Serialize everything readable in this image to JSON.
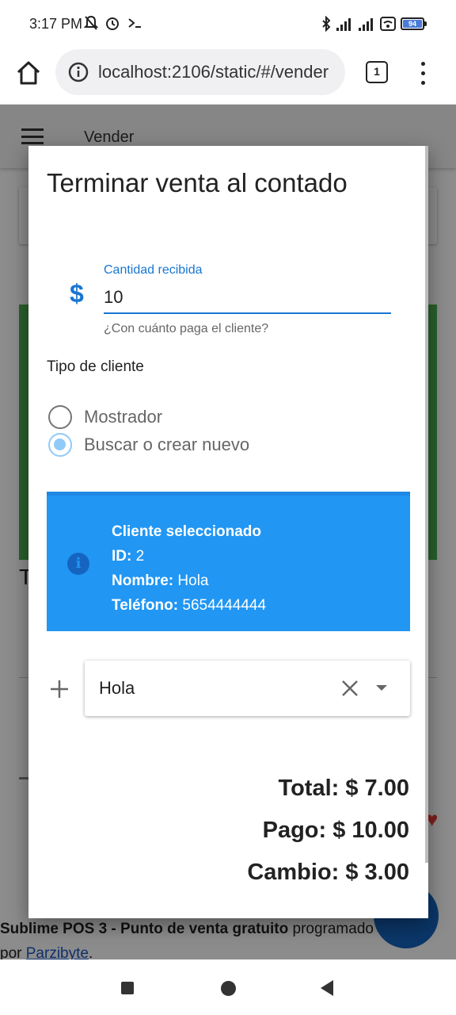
{
  "status_bar": {
    "time": "3:17 PM",
    "left_icons": [
      "notifications-off-icon",
      "alarm-icon",
      "terminal-icon"
    ],
    "right_icons": [
      "bluetooth-icon",
      "signal-icon",
      "signal-icon",
      "wifi-icon"
    ],
    "battery_level": "94"
  },
  "browser": {
    "url": "localhost:2106/static/#/vender",
    "tab_count": "1"
  },
  "app": {
    "title": "Vender"
  },
  "dialog": {
    "title": "Terminar venta al contado",
    "amount_field": {
      "label": "Cantidad recibida",
      "value": "10",
      "hint": "¿Con cuánto paga el cliente?"
    },
    "client_type_label": "Tipo de cliente",
    "client_types": [
      {
        "label": "Mostrador",
        "selected": false
      },
      {
        "label": "Buscar o crear nuevo",
        "selected": true
      }
    ],
    "selected_client": {
      "heading": "Cliente seleccionado",
      "id_label": "ID:",
      "id_value": "2",
      "name_label": "Nombre:",
      "name_value": "Hola",
      "phone_label": "Teléfono:",
      "phone_value": "5654444444"
    },
    "client_select": {
      "value": "Hola"
    },
    "totals": {
      "total": "Total: $ 7.00",
      "pago": "Pago: $ 10.00",
      "cambio": "Cambio: $ 3.00"
    }
  },
  "footer": {
    "brand": "Sublime POS 3 - Punto de venta gratuito",
    "text": " programado",
    "by": "por ",
    "link": "Parzibyte",
    "end": "."
  },
  "colors": {
    "primary": "#1976d2",
    "info": "#2196f3",
    "success": "#4caf50"
  }
}
